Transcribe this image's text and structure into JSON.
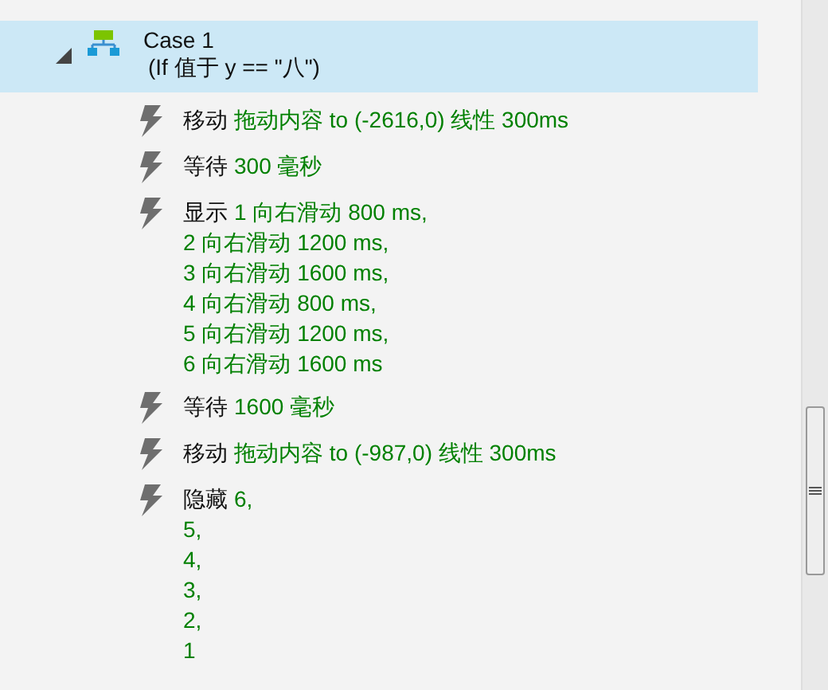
{
  "case": {
    "label": "Case 1",
    "condition": "(If 值于 y == \"八\")",
    "expanded": true,
    "selected": true
  },
  "actions": [
    {
      "verb": "移动",
      "lines": [
        "拖动内容 to (-2616,0) 线性 300ms"
      ]
    },
    {
      "verb": "等待",
      "lines": [
        "300 毫秒"
      ]
    },
    {
      "verb": "显示",
      "lines": [
        "1 向右滑动 800 ms,",
        "2 向右滑动 1200 ms,",
        "3 向右滑动 1600 ms,",
        "4 向右滑动 800 ms,",
        "5 向右滑动 1200 ms,",
        "6 向右滑动 1600 ms"
      ]
    },
    {
      "verb": "等待",
      "lines": [
        "1600 毫秒"
      ]
    },
    {
      "verb": "移动",
      "lines": [
        "拖动内容 to (-987,0) 线性 300ms"
      ]
    },
    {
      "verb": "隐藏",
      "lines": [
        "6,",
        "5,",
        "4,",
        "3,",
        "2,",
        "1"
      ]
    }
  ]
}
